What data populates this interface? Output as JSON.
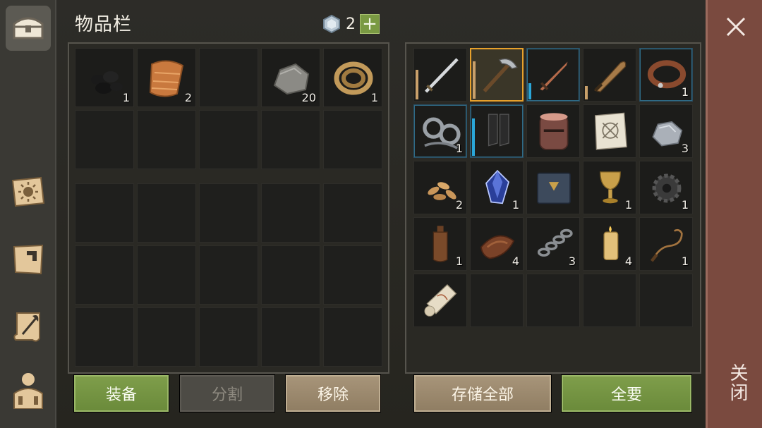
{
  "header": {
    "title": "物品栏",
    "currency_icon": "gem-icon",
    "currency_value": "2",
    "add_label": "+"
  },
  "tabs": [
    {
      "icon": "chest-icon",
      "active": true
    },
    {
      "icon": "sun-book-icon",
      "active": false
    },
    {
      "icon": "crafting-arrow-icon",
      "active": false
    },
    {
      "icon": "scroll-quill-icon",
      "active": false
    },
    {
      "icon": "character-icon",
      "active": false
    }
  ],
  "backpack": {
    "slots": [
      {
        "icon": "coal-icon",
        "count": "1"
      },
      {
        "icon": "cloth-icon",
        "count": "2"
      },
      {
        "icon": "",
        "count": ""
      },
      {
        "icon": "stone-icon",
        "count": "20"
      },
      {
        "icon": "rope-icon",
        "count": "1"
      }
    ]
  },
  "storage": {
    "slots": [
      {
        "icon": "sword-icon",
        "count": "",
        "durability": 0.55
      },
      {
        "icon": "pickaxe-icon",
        "count": "",
        "durability": 0.7,
        "selected": true
      },
      {
        "icon": "dagger-icon",
        "count": "",
        "durability": 0.3,
        "blue": true
      },
      {
        "icon": "machete-icon",
        "count": "",
        "durability": 0.25
      },
      {
        "icon": "collar-icon",
        "count": "1",
        "blue": true
      },
      {
        "icon": "shackles-icon",
        "count": "1",
        "blue": true
      },
      {
        "icon": "boots-icon",
        "count": "",
        "durability": 0.7,
        "blue": true
      },
      {
        "icon": "helmet-icon",
        "count": ""
      },
      {
        "icon": "map-icon",
        "count": ""
      },
      {
        "icon": "iron-ore-icon",
        "count": "3"
      },
      {
        "icon": "seeds-icon",
        "count": "2"
      },
      {
        "icon": "crystal-icon",
        "count": "1"
      },
      {
        "icon": "book-icon",
        "count": ""
      },
      {
        "icon": "goblet-icon",
        "count": "1"
      },
      {
        "icon": "gear-icon",
        "count": "1"
      },
      {
        "icon": "bottle-icon",
        "count": "1"
      },
      {
        "icon": "leather-icon",
        "count": "4"
      },
      {
        "icon": "chain-icon",
        "count": "3"
      },
      {
        "icon": "candle-icon",
        "count": "4"
      },
      {
        "icon": "whip-icon",
        "count": "1"
      },
      {
        "icon": "scroll-icon",
        "count": ""
      }
    ]
  },
  "buttons": {
    "equip": "装备",
    "split": "分割",
    "remove": "移除",
    "store_all": "存储全部",
    "take_all": "全要"
  },
  "close": {
    "label": "关闭",
    "icon": "close-icon"
  },
  "colors": {
    "accent_green": "#7a9a43",
    "selected_border": "#e7a12c",
    "close_bg": "#7a4a3f"
  }
}
